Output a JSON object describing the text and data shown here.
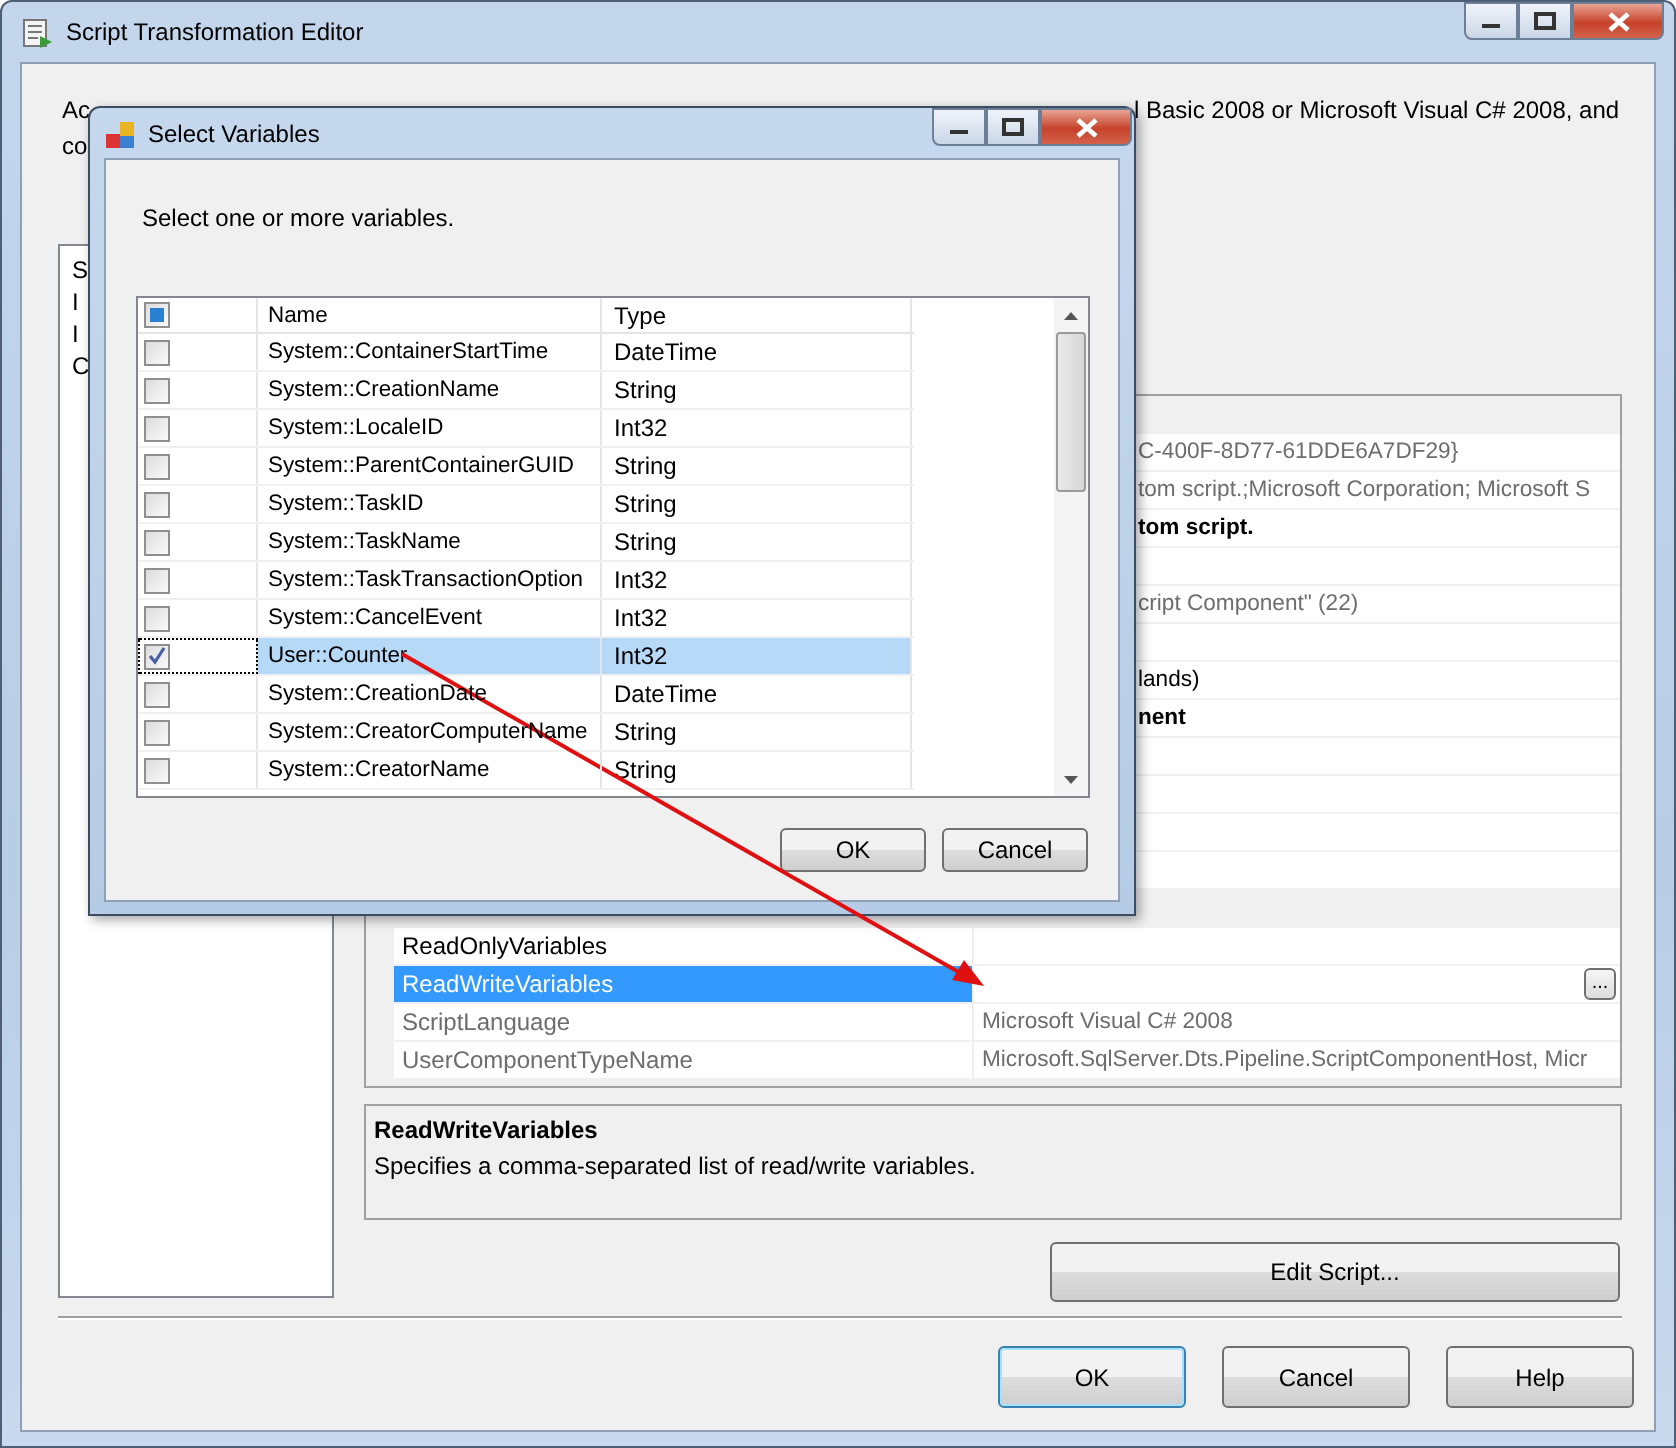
{
  "window": {
    "title": "Script Transformation Editor"
  },
  "description": {
    "line_1_start": "Ac",
    "line_1_end": "l Basic 2008 or Microsoft Visual C# 2008, and",
    "line_2_start": "co"
  },
  "pages": [
    {
      "label": "S"
    },
    {
      "label": "I"
    },
    {
      "label": "I"
    },
    {
      "label": "C"
    }
  ],
  "properties": [
    {
      "kind": "category"
    },
    {
      "kind": "fragment",
      "value": "C-400F-8D77-61DDE6A7DF29}",
      "readonly": true,
      "bold": false
    },
    {
      "kind": "fragment",
      "value": "tom script.;Microsoft Corporation; Microsoft S",
      "readonly": true,
      "bold": false
    },
    {
      "kind": "fragment",
      "value": "tom script.",
      "readonly": false,
      "bold": true
    },
    {
      "kind": "hidden"
    },
    {
      "kind": "fragment",
      "value": "cript Component\" (22)",
      "readonly": true,
      "bold": false
    },
    {
      "kind": "hidden"
    },
    {
      "kind": "fragment",
      "value": "lands)",
      "readonly": false,
      "bold": false
    },
    {
      "kind": "fragment",
      "value": "nent",
      "readonly": false,
      "bold": true
    },
    {
      "kind": "hidden"
    },
    {
      "kind": "hidden"
    },
    {
      "kind": "hidden"
    },
    {
      "kind": "hidden"
    },
    {
      "kind": "category"
    },
    {
      "kind": "property",
      "name": "ReadOnlyVariables",
      "readonly": false,
      "selected": false
    },
    {
      "kind": "property",
      "name": "ReadWriteVariables",
      "readonly": false,
      "selected": true,
      "button": "..."
    },
    {
      "kind": "property",
      "name": "ScriptLanguage",
      "value": "Microsoft Visual C# 2008",
      "readonly": true,
      "selected": false
    },
    {
      "kind": "property",
      "name": "UserComponentTypeName",
      "value": "Microsoft.SqlServer.Dts.Pipeline.ScriptComponentHost, Micr",
      "readonly": true,
      "selected": false
    }
  ],
  "help": {
    "title": "ReadWriteVariables",
    "text": "Specifies a comma-separated list of read/write variables."
  },
  "edit_script_button": "Edit Script...",
  "buttons": [
    {
      "label": "OK",
      "default": true
    },
    {
      "label": "Cancel",
      "default": false
    },
    {
      "label": "Help",
      "default": false
    }
  ],
  "dialog": {
    "title": "Select Variables",
    "instruction": "Select one or more variables.",
    "header_partial": true,
    "columns": [
      "Name",
      "Type"
    ],
    "rows": [
      {
        "name": "System::ContainerStartTime",
        "type": "DateTime",
        "checked": false,
        "selected": false
      },
      {
        "name": "System::CreationName",
        "type": "String",
        "checked": false,
        "selected": false
      },
      {
        "name": "System::LocaleID",
        "type": "Int32",
        "checked": false,
        "selected": false
      },
      {
        "name": "System::ParentContainerGUID",
        "type": "String",
        "checked": false,
        "selected": false
      },
      {
        "name": "System::TaskID",
        "type": "String",
        "checked": false,
        "selected": false
      },
      {
        "name": "System::TaskName",
        "type": "String",
        "checked": false,
        "selected": false
      },
      {
        "name": "System::TaskTransactionOption",
        "type": "Int32",
        "checked": false,
        "selected": false
      },
      {
        "name": "System::CancelEvent",
        "type": "Int32",
        "checked": false,
        "selected": false
      },
      {
        "name": "User::Counter",
        "type": "Int32",
        "checked": true,
        "selected": true
      },
      {
        "name": "System::CreationDate",
        "type": "DateTime",
        "checked": false,
        "selected": false
      },
      {
        "name": "System::CreatorComputerName",
        "type": "String",
        "checked": false,
        "selected": false
      },
      {
        "name": "System::CreatorName",
        "type": "String",
        "checked": false,
        "selected": false
      }
    ],
    "buttons": [
      {
        "label": "OK"
      },
      {
        "label": "Cancel"
      }
    ]
  }
}
